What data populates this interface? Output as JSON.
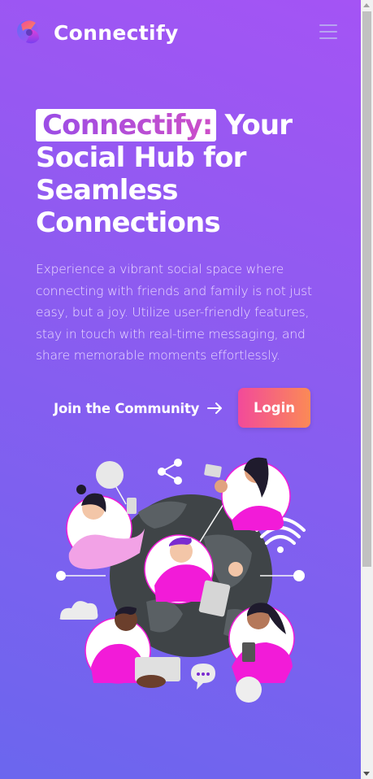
{
  "header": {
    "brand": "Connectify",
    "logo_icon": "connectify-logo-icon",
    "menu_icon": "hamburger-menu-icon"
  },
  "hero": {
    "title_highlight": "Connectify:",
    "title_rest_1": " Your",
    "title_rest_2": "Social Hub for",
    "title_rest_3": "Seamless",
    "title_rest_4": "Connections",
    "description": "Experience a vibrant social space where connecting with friends and family is not just easy, but a joy. Utilize user-friendly features, stay in touch with real-time messaging, and share memorable moments effortlessly.",
    "join_label": "Join the Community",
    "join_icon": "arrow-right-icon",
    "login_label": "Login"
  },
  "colors": {
    "background_top": "#a454f4",
    "background_bottom": "#6b66ee",
    "login_start": "#f24a9a",
    "login_end": "#fb8a56",
    "accent_pink": "#f21bd8"
  }
}
